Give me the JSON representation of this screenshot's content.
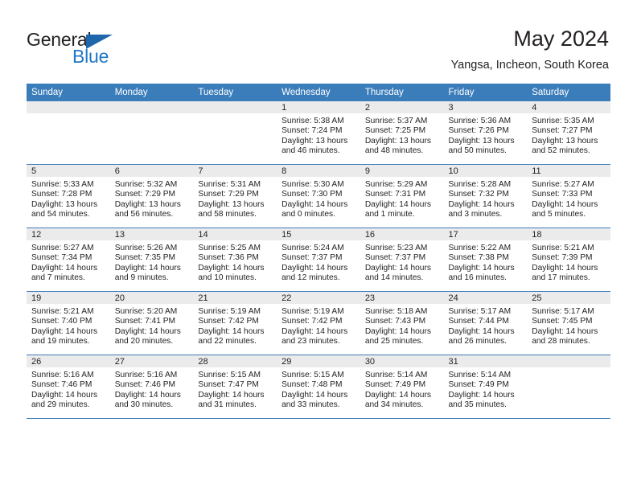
{
  "logo": {
    "word_top": "General",
    "word_bottom": "Blue",
    "accent_color": "#1f67ac",
    "blue_text_color": "#2077c4"
  },
  "header": {
    "title": "May 2024",
    "subtitle": "Yangsa, Incheon, South Korea"
  },
  "theme": {
    "header_row_bg": "#3b7cba",
    "daynum_bg": "#ebebeb",
    "text_color": "#231f20"
  },
  "weekdays": [
    "Sunday",
    "Monday",
    "Tuesday",
    "Wednesday",
    "Thursday",
    "Friday",
    "Saturday"
  ],
  "weeks": [
    [
      {
        "day": "",
        "sunrise": "",
        "sunset": "",
        "daylight_a": "",
        "daylight_b": ""
      },
      {
        "day": "",
        "sunrise": "",
        "sunset": "",
        "daylight_a": "",
        "daylight_b": ""
      },
      {
        "day": "",
        "sunrise": "",
        "sunset": "",
        "daylight_a": "",
        "daylight_b": ""
      },
      {
        "day": "1",
        "sunrise": "Sunrise: 5:38 AM",
        "sunset": "Sunset: 7:24 PM",
        "daylight_a": "Daylight: 13 hours",
        "daylight_b": "and 46 minutes."
      },
      {
        "day": "2",
        "sunrise": "Sunrise: 5:37 AM",
        "sunset": "Sunset: 7:25 PM",
        "daylight_a": "Daylight: 13 hours",
        "daylight_b": "and 48 minutes."
      },
      {
        "day": "3",
        "sunrise": "Sunrise: 5:36 AM",
        "sunset": "Sunset: 7:26 PM",
        "daylight_a": "Daylight: 13 hours",
        "daylight_b": "and 50 minutes."
      },
      {
        "day": "4",
        "sunrise": "Sunrise: 5:35 AM",
        "sunset": "Sunset: 7:27 PM",
        "daylight_a": "Daylight: 13 hours",
        "daylight_b": "and 52 minutes."
      }
    ],
    [
      {
        "day": "5",
        "sunrise": "Sunrise: 5:33 AM",
        "sunset": "Sunset: 7:28 PM",
        "daylight_a": "Daylight: 13 hours",
        "daylight_b": "and 54 minutes."
      },
      {
        "day": "6",
        "sunrise": "Sunrise: 5:32 AM",
        "sunset": "Sunset: 7:29 PM",
        "daylight_a": "Daylight: 13 hours",
        "daylight_b": "and 56 minutes."
      },
      {
        "day": "7",
        "sunrise": "Sunrise: 5:31 AM",
        "sunset": "Sunset: 7:29 PM",
        "daylight_a": "Daylight: 13 hours",
        "daylight_b": "and 58 minutes."
      },
      {
        "day": "8",
        "sunrise": "Sunrise: 5:30 AM",
        "sunset": "Sunset: 7:30 PM",
        "daylight_a": "Daylight: 14 hours",
        "daylight_b": "and 0 minutes."
      },
      {
        "day": "9",
        "sunrise": "Sunrise: 5:29 AM",
        "sunset": "Sunset: 7:31 PM",
        "daylight_a": "Daylight: 14 hours",
        "daylight_b": "and 1 minute."
      },
      {
        "day": "10",
        "sunrise": "Sunrise: 5:28 AM",
        "sunset": "Sunset: 7:32 PM",
        "daylight_a": "Daylight: 14 hours",
        "daylight_b": "and 3 minutes."
      },
      {
        "day": "11",
        "sunrise": "Sunrise: 5:27 AM",
        "sunset": "Sunset: 7:33 PM",
        "daylight_a": "Daylight: 14 hours",
        "daylight_b": "and 5 minutes."
      }
    ],
    [
      {
        "day": "12",
        "sunrise": "Sunrise: 5:27 AM",
        "sunset": "Sunset: 7:34 PM",
        "daylight_a": "Daylight: 14 hours",
        "daylight_b": "and 7 minutes."
      },
      {
        "day": "13",
        "sunrise": "Sunrise: 5:26 AM",
        "sunset": "Sunset: 7:35 PM",
        "daylight_a": "Daylight: 14 hours",
        "daylight_b": "and 9 minutes."
      },
      {
        "day": "14",
        "sunrise": "Sunrise: 5:25 AM",
        "sunset": "Sunset: 7:36 PM",
        "daylight_a": "Daylight: 14 hours",
        "daylight_b": "and 10 minutes."
      },
      {
        "day": "15",
        "sunrise": "Sunrise: 5:24 AM",
        "sunset": "Sunset: 7:37 PM",
        "daylight_a": "Daylight: 14 hours",
        "daylight_b": "and 12 minutes."
      },
      {
        "day": "16",
        "sunrise": "Sunrise: 5:23 AM",
        "sunset": "Sunset: 7:37 PM",
        "daylight_a": "Daylight: 14 hours",
        "daylight_b": "and 14 minutes."
      },
      {
        "day": "17",
        "sunrise": "Sunrise: 5:22 AM",
        "sunset": "Sunset: 7:38 PM",
        "daylight_a": "Daylight: 14 hours",
        "daylight_b": "and 16 minutes."
      },
      {
        "day": "18",
        "sunrise": "Sunrise: 5:21 AM",
        "sunset": "Sunset: 7:39 PM",
        "daylight_a": "Daylight: 14 hours",
        "daylight_b": "and 17 minutes."
      }
    ],
    [
      {
        "day": "19",
        "sunrise": "Sunrise: 5:21 AM",
        "sunset": "Sunset: 7:40 PM",
        "daylight_a": "Daylight: 14 hours",
        "daylight_b": "and 19 minutes."
      },
      {
        "day": "20",
        "sunrise": "Sunrise: 5:20 AM",
        "sunset": "Sunset: 7:41 PM",
        "daylight_a": "Daylight: 14 hours",
        "daylight_b": "and 20 minutes."
      },
      {
        "day": "21",
        "sunrise": "Sunrise: 5:19 AM",
        "sunset": "Sunset: 7:42 PM",
        "daylight_a": "Daylight: 14 hours",
        "daylight_b": "and 22 minutes."
      },
      {
        "day": "22",
        "sunrise": "Sunrise: 5:19 AM",
        "sunset": "Sunset: 7:42 PM",
        "daylight_a": "Daylight: 14 hours",
        "daylight_b": "and 23 minutes."
      },
      {
        "day": "23",
        "sunrise": "Sunrise: 5:18 AM",
        "sunset": "Sunset: 7:43 PM",
        "daylight_a": "Daylight: 14 hours",
        "daylight_b": "and 25 minutes."
      },
      {
        "day": "24",
        "sunrise": "Sunrise: 5:17 AM",
        "sunset": "Sunset: 7:44 PM",
        "daylight_a": "Daylight: 14 hours",
        "daylight_b": "and 26 minutes."
      },
      {
        "day": "25",
        "sunrise": "Sunrise: 5:17 AM",
        "sunset": "Sunset: 7:45 PM",
        "daylight_a": "Daylight: 14 hours",
        "daylight_b": "and 28 minutes."
      }
    ],
    [
      {
        "day": "26",
        "sunrise": "Sunrise: 5:16 AM",
        "sunset": "Sunset: 7:46 PM",
        "daylight_a": "Daylight: 14 hours",
        "daylight_b": "and 29 minutes."
      },
      {
        "day": "27",
        "sunrise": "Sunrise: 5:16 AM",
        "sunset": "Sunset: 7:46 PM",
        "daylight_a": "Daylight: 14 hours",
        "daylight_b": "and 30 minutes."
      },
      {
        "day": "28",
        "sunrise": "Sunrise: 5:15 AM",
        "sunset": "Sunset: 7:47 PM",
        "daylight_a": "Daylight: 14 hours",
        "daylight_b": "and 31 minutes."
      },
      {
        "day": "29",
        "sunrise": "Sunrise: 5:15 AM",
        "sunset": "Sunset: 7:48 PM",
        "daylight_a": "Daylight: 14 hours",
        "daylight_b": "and 33 minutes."
      },
      {
        "day": "30",
        "sunrise": "Sunrise: 5:14 AM",
        "sunset": "Sunset: 7:49 PM",
        "daylight_a": "Daylight: 14 hours",
        "daylight_b": "and 34 minutes."
      },
      {
        "day": "31",
        "sunrise": "Sunrise: 5:14 AM",
        "sunset": "Sunset: 7:49 PM",
        "daylight_a": "Daylight: 14 hours",
        "daylight_b": "and 35 minutes."
      },
      {
        "day": "",
        "sunrise": "",
        "sunset": "",
        "daylight_a": "",
        "daylight_b": ""
      }
    ]
  ]
}
